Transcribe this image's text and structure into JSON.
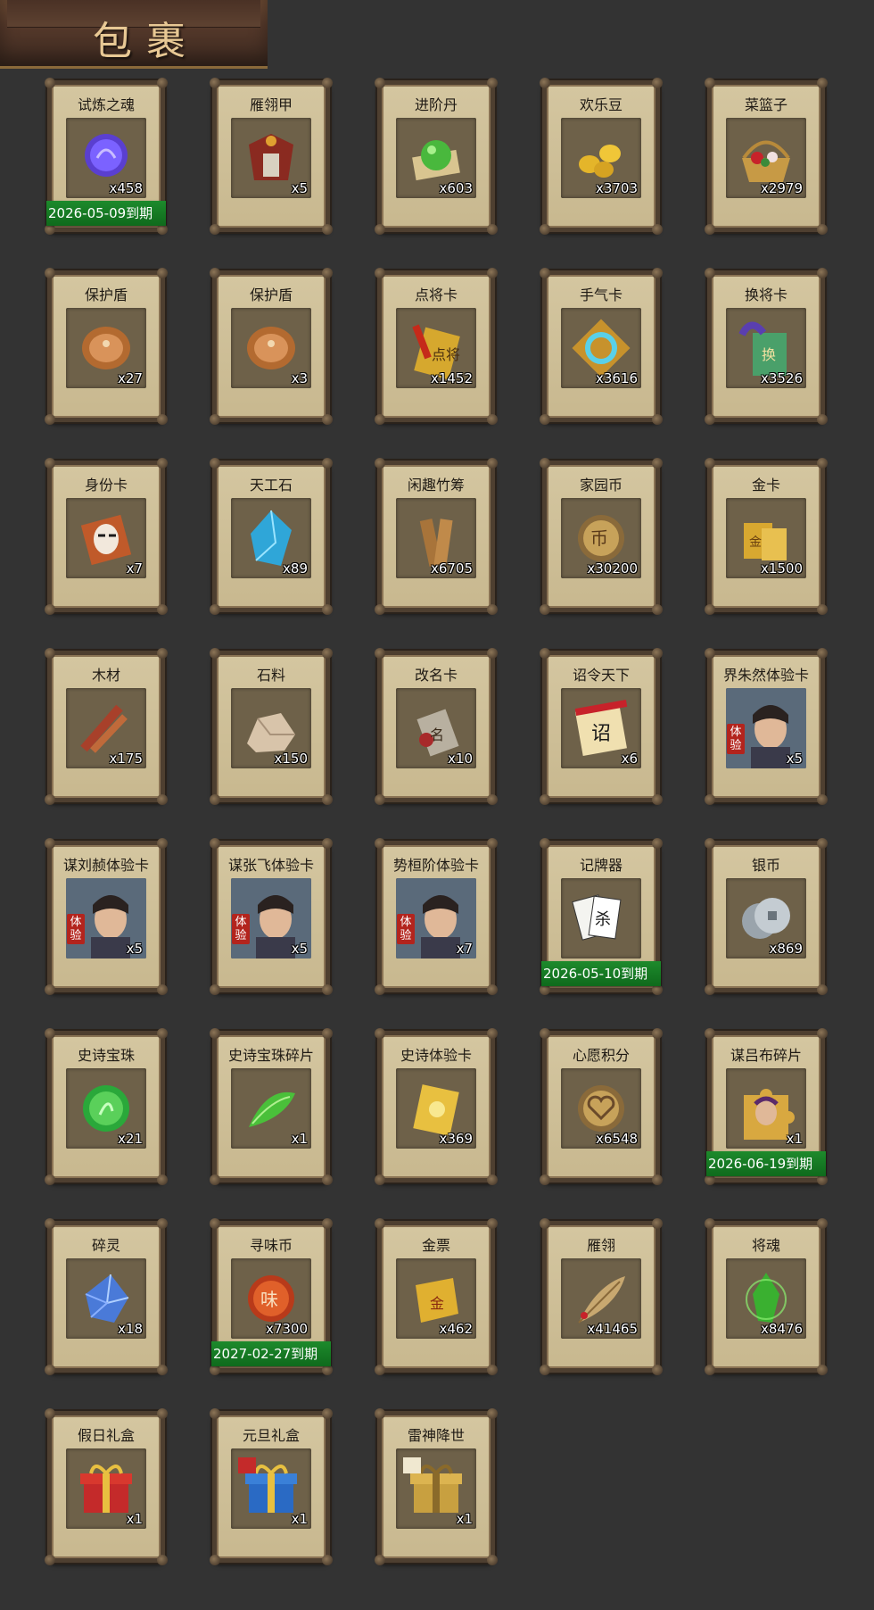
{
  "header": {
    "title": "包裹"
  },
  "items": [
    {
      "name": "试炼之魂",
      "count": "x458",
      "icon": "purple-orb-icon",
      "expiry": "2026-05-09到期"
    },
    {
      "name": "雁翎甲",
      "count": "x5",
      "icon": "armor-icon"
    },
    {
      "name": "进阶丹",
      "count": "x603",
      "icon": "green-pill-icon"
    },
    {
      "name": "欢乐豆",
      "count": "x3703",
      "icon": "gold-beans-icon"
    },
    {
      "name": "菜篮子",
      "count": "x2979",
      "icon": "flower-basket-icon"
    },
    {
      "name": "保护盾",
      "count": "x27",
      "icon": "shield-icon"
    },
    {
      "name": "保护盾",
      "count": "x3",
      "icon": "shield-icon"
    },
    {
      "name": "点将卡",
      "count": "x1452",
      "icon": "general-card-icon"
    },
    {
      "name": "手气卡",
      "count": "x3616",
      "icon": "luck-card-icon"
    },
    {
      "name": "换将卡",
      "count": "x3526",
      "icon": "swap-card-icon"
    },
    {
      "name": "身份卡",
      "count": "x7",
      "icon": "mask-card-icon"
    },
    {
      "name": "天工石",
      "count": "x89",
      "icon": "blue-crystal-icon"
    },
    {
      "name": "闲趣竹筹",
      "count": "x6705",
      "icon": "bamboo-token-icon"
    },
    {
      "name": "家园币",
      "count": "x30200",
      "icon": "home-coin-icon"
    },
    {
      "name": "金卡",
      "count": "x1500",
      "icon": "gold-card-icon"
    },
    {
      "name": "木材",
      "count": "x175",
      "icon": "wood-icon"
    },
    {
      "name": "石料",
      "count": "x150",
      "icon": "stone-icon"
    },
    {
      "name": "改名卡",
      "count": "x10",
      "icon": "rename-card-icon"
    },
    {
      "name": "诏令天下",
      "count": "x6",
      "icon": "edict-scroll-icon"
    },
    {
      "name": "界朱然体验卡",
      "count": "x5",
      "icon": "hero-portrait-icon",
      "trial": "体验"
    },
    {
      "name": "谋刘赪体验卡",
      "count": "x5",
      "icon": "hero-portrait-icon",
      "trial": "体验"
    },
    {
      "name": "谋张飞体验卡",
      "count": "x5",
      "icon": "hero-portrait-icon",
      "trial": "体验"
    },
    {
      "name": "势桓阶体验卡",
      "count": "x7",
      "icon": "hero-portrait-icon",
      "trial": "体验"
    },
    {
      "name": "记牌器",
      "count": "",
      "icon": "playing-cards-icon",
      "expiry": "2026-05-10到期"
    },
    {
      "name": "银币",
      "count": "x869",
      "icon": "silver-coin-icon"
    },
    {
      "name": "史诗宝珠",
      "count": "x21",
      "icon": "green-orb-icon"
    },
    {
      "name": "史诗宝珠碎片",
      "count": "x1",
      "icon": "green-shard-icon"
    },
    {
      "name": "史诗体验卡",
      "count": "x369",
      "icon": "epic-card-icon"
    },
    {
      "name": "心愿积分",
      "count": "x6548",
      "icon": "heart-coin-icon"
    },
    {
      "name": "谋吕布碎片",
      "count": "x1",
      "icon": "puzzle-piece-icon",
      "expiry": "2026-06-19到期"
    },
    {
      "name": "碎灵",
      "count": "x18",
      "icon": "blue-shard-icon"
    },
    {
      "name": "寻味币",
      "count": "x7300",
      "icon": "taste-coin-icon",
      "expiry": "2027-02-27到期"
    },
    {
      "name": "金票",
      "count": "x462",
      "icon": "gold-ticket-icon"
    },
    {
      "name": "雁翎",
      "count": "x41465",
      "icon": "feather-icon"
    },
    {
      "name": "将魂",
      "count": "x8476",
      "icon": "green-soul-icon"
    },
    {
      "name": "假日礼盒",
      "count": "x1",
      "icon": "red-gift-icon"
    },
    {
      "name": "元旦礼盒",
      "count": "x1",
      "icon": "blue-gift-icon"
    },
    {
      "name": "雷神降世",
      "count": "x1",
      "icon": "gold-gift-icon"
    }
  ],
  "colors": {
    "background": "#333333",
    "card": "#cdbf97",
    "expiry": "#1a7d28",
    "trial": "#b3241d"
  }
}
